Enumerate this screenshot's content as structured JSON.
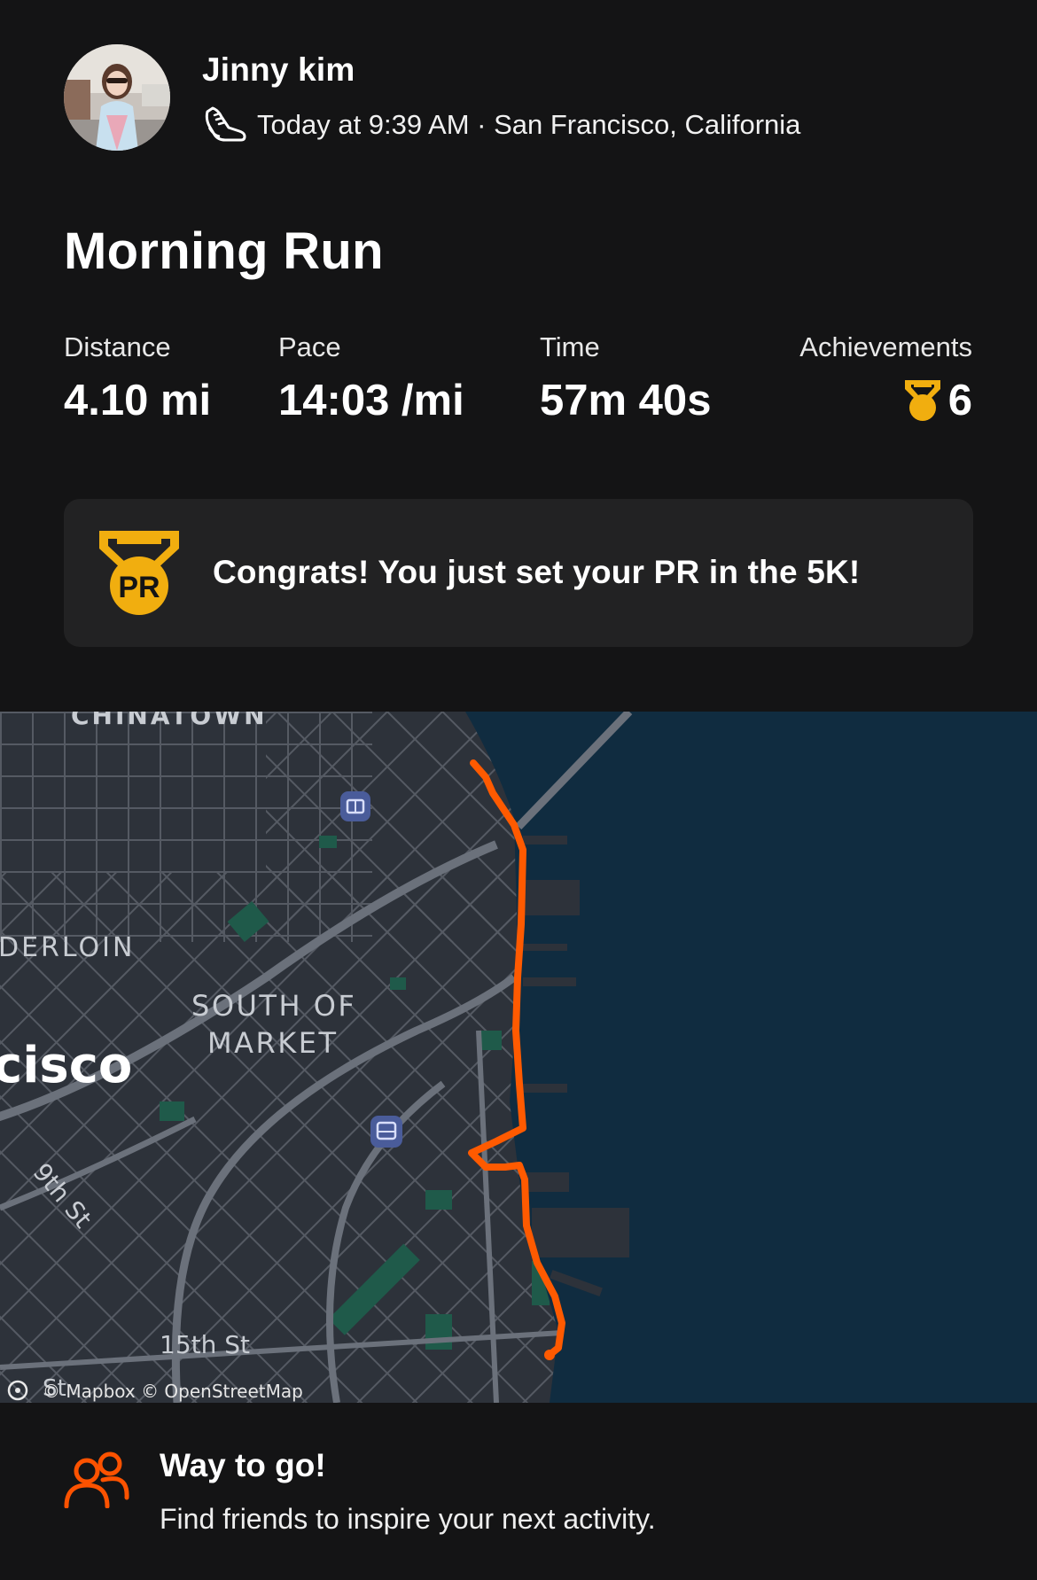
{
  "header": {
    "user_name": "Jinny kim",
    "activity_icon": "running-shoe-icon",
    "meta": "Today at 9:39 AM · San Francisco, California"
  },
  "activity": {
    "title": "Morning Run"
  },
  "stats": {
    "distance": {
      "label": "Distance",
      "value": "4.10 mi"
    },
    "pace": {
      "label": "Pace",
      "value": "14:03 /mi"
    },
    "time": {
      "label": "Time",
      "value": "57m 40s"
    },
    "achievements": {
      "label": "Achievements",
      "value": "6",
      "icon": "medal-icon"
    }
  },
  "pr_banner": {
    "icon": "pr-medal-icon",
    "message": "Congrats! You just set your PR in the 5K!"
  },
  "map": {
    "labels": {
      "chinatown": "CHINATOWN",
      "tenderloin": "DERLOIN",
      "soma_line1": "SOUTH OF",
      "soma_line2": "MARKET",
      "city": "cisco",
      "ninth_st": "9th St",
      "fifteenth_st": "15th St",
      "sixteenth_st": "St",
      "attribution": "© Mapbox © OpenStreetMap"
    },
    "route_color": "#ff5a00",
    "water_color": "#102c40"
  },
  "footer": {
    "icon": "friends-icon",
    "title": "Way to go!",
    "subtitle": "Find friends to inspire your next activity."
  },
  "colors": {
    "background": "#141415",
    "card": "#222223",
    "gold": "#f1ae0f",
    "accent": "#fc5200"
  }
}
